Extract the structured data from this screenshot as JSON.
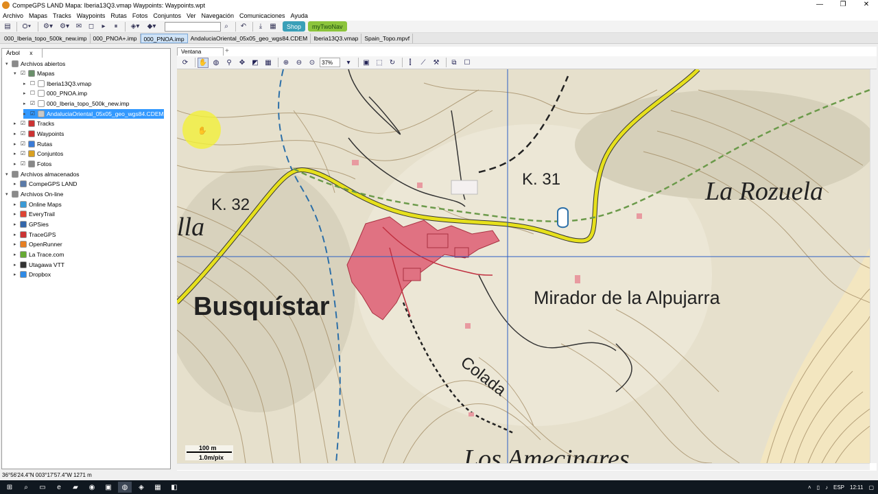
{
  "window": {
    "title": "CompeGPS LAND Mapa: Iberia13Q3.vmap Waypoints: Waypoints.wpt",
    "min": "—",
    "max": "❐",
    "close": "✕"
  },
  "menu": [
    "Archivo",
    "Mapas",
    "Tracks",
    "Waypoints",
    "Rutas",
    "Fotos",
    "Conjuntos",
    "Ver",
    "Navegación",
    "Comunicaciones",
    "Ayuda"
  ],
  "toolbar": {
    "search_value": "",
    "shop_label": "Shop",
    "mytwonav_label": "myTwoNav"
  },
  "file_tabs": [
    "000_Iberia_topo_500k_new.imp",
    "000_PNOA+.imp",
    "000_PNOA.imp",
    "AndaluciaOriental_05x05_geo_wgs84.CDEM",
    "Iberia13Q3.vmap",
    "Spain_Topo.mpvf"
  ],
  "left_panel": {
    "tab_label": "Árbol",
    "tab_close": "x",
    "tree": [
      {
        "label": "Archivos abiertos",
        "exp": "▾",
        "cb": "",
        "color": "#8a8a8a"
      },
      {
        "label": "Mapas",
        "exp": "▾",
        "cb": "☑",
        "color": "#6a8f6a"
      },
      {
        "label": "Iberia13Q3.vmap",
        "exp": "▸",
        "cb": "☐",
        "color": "#ffffff"
      },
      {
        "label": "000_PNOA.imp",
        "exp": "▸",
        "cb": "☐",
        "color": "#ffffff"
      },
      {
        "label": "000_Iberia_topo_500k_new.imp",
        "exp": "▸",
        "cb": "☑",
        "color": "#ffffff"
      },
      {
        "label": "AndaluciaOriental_05x05_geo_wgs84.CDEM",
        "exp": "▸",
        "cb": "☑",
        "color": "#c8c8c8"
      },
      {
        "label": "Tracks",
        "exp": "▸",
        "cb": "☑",
        "color": "#c33"
      },
      {
        "label": "Waypoints",
        "exp": "▸",
        "cb": "☑",
        "color": "#c33"
      },
      {
        "label": "Rutas",
        "exp": "▸",
        "cb": "☑",
        "color": "#3a7ad6"
      },
      {
        "label": "Conjuntos",
        "exp": "▸",
        "cb": "☑",
        "color": "#d9a020"
      },
      {
        "label": "Fotos",
        "exp": "▸",
        "cb": "☑",
        "color": "#888"
      },
      {
        "label": "Archivos almacenados",
        "exp": "▾",
        "cb": "",
        "color": "#8a8a8a"
      },
      {
        "label": "CompeGPS LAND",
        "exp": "▸",
        "cb": "",
        "color": "#5a7aa8"
      },
      {
        "label": "Archivos On-line",
        "exp": "▾",
        "cb": "",
        "color": "#8a8a8a"
      },
      {
        "label": "Online Maps",
        "exp": "▸",
        "cb": "",
        "color": "#3a9ad6"
      },
      {
        "label": "EveryTrail",
        "exp": "▸",
        "cb": "",
        "color": "#d43"
      },
      {
        "label": "GPSies",
        "exp": "▸",
        "cb": "",
        "color": "#36a"
      },
      {
        "label": "TraceGPS",
        "exp": "▸",
        "cb": "",
        "color": "#c33"
      },
      {
        "label": "OpenRunner",
        "exp": "▸",
        "cb": "",
        "color": "#e67e22"
      },
      {
        "label": "La Trace.com",
        "exp": "▸",
        "cb": "",
        "color": "#6a3"
      },
      {
        "label": "Utagawa VTT",
        "exp": "▸",
        "cb": "",
        "color": "#333"
      },
      {
        "label": "Dropbox",
        "exp": "▸",
        "cb": "",
        "color": "#2e8ae6"
      }
    ]
  },
  "map_window": {
    "tab_label": "Ventana principal",
    "tab_add": "+",
    "zoom_value": "37%",
    "labels": {
      "busquistar": "Busquístar",
      "mirador": "Mirador de la Alpujarra",
      "rozuela": "La Rozuela",
      "k31": "K. 31",
      "k32": "K. 32",
      "colada": "Colada",
      "amecinares": "Los Amecinares",
      "illa": "lla"
    },
    "scale_distance": "100 m",
    "scale_res": "1.0m/pix"
  },
  "status": {
    "coords": "36°56'24.4\"N 003°17'57.4\"W 1271 m"
  },
  "taskbar": {
    "lang": "ESP",
    "time": "12:11"
  }
}
